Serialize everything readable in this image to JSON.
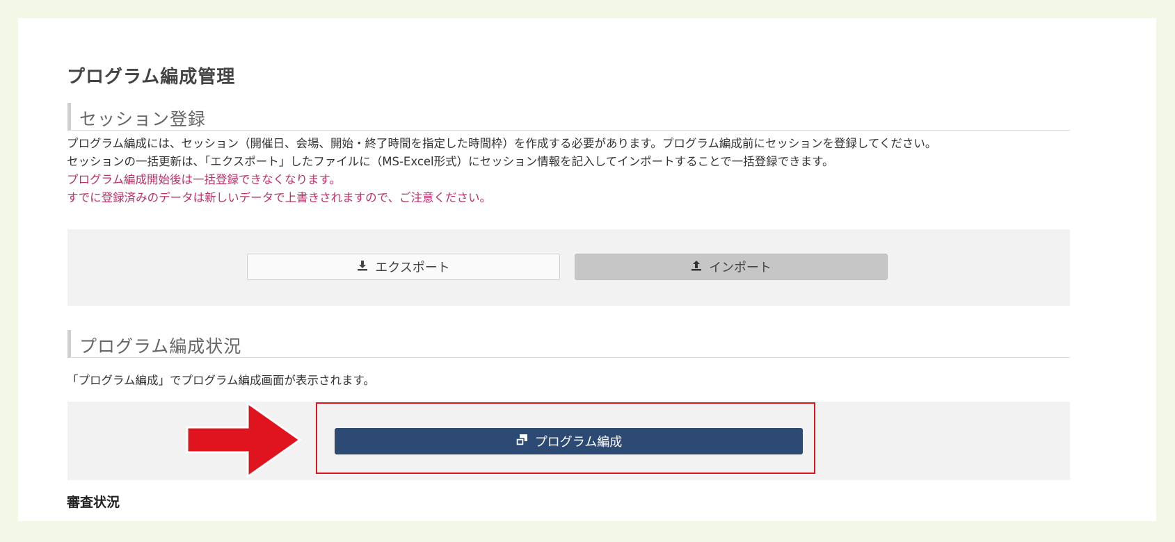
{
  "page": {
    "title": "プログラム編成管理"
  },
  "session_section": {
    "heading": "セッション登録",
    "lines": [
      "プログラム編成には、セッション（開催日、会場、開始・終了時間を指定した時間枠）を作成する必要があります。プログラム編成前にセッションを登録してください。",
      "セッションの一括更新は、「エクスポート」したファイルに（MS-Excel形式）にセッション情報を記入してインポートすることで一括登録できます。"
    ],
    "warnings": [
      "プログラム編成開始後は一括登録できなくなります。",
      "すでに登録済みのデータは新しいデータで上書きされますので、ご注意ください。"
    ],
    "export_label": "エクスポート",
    "import_label": "インポート"
  },
  "program_section": {
    "heading": "プログラム編成状況",
    "description": "「プログラム編成」でプログラム編成画面が表示されます。",
    "program_button_label": "プログラム編成"
  },
  "review_section": {
    "heading": "審査状況"
  },
  "icons": {
    "export": "download-icon",
    "import": "upload-icon",
    "program": "window-restore-icon",
    "annotation": "red-arrow-icon"
  },
  "colors": {
    "background": "#f2f7e6",
    "primary_button": "#2c4a73",
    "warning_text": "#c0306a",
    "annotation_red": "#e0141e"
  }
}
